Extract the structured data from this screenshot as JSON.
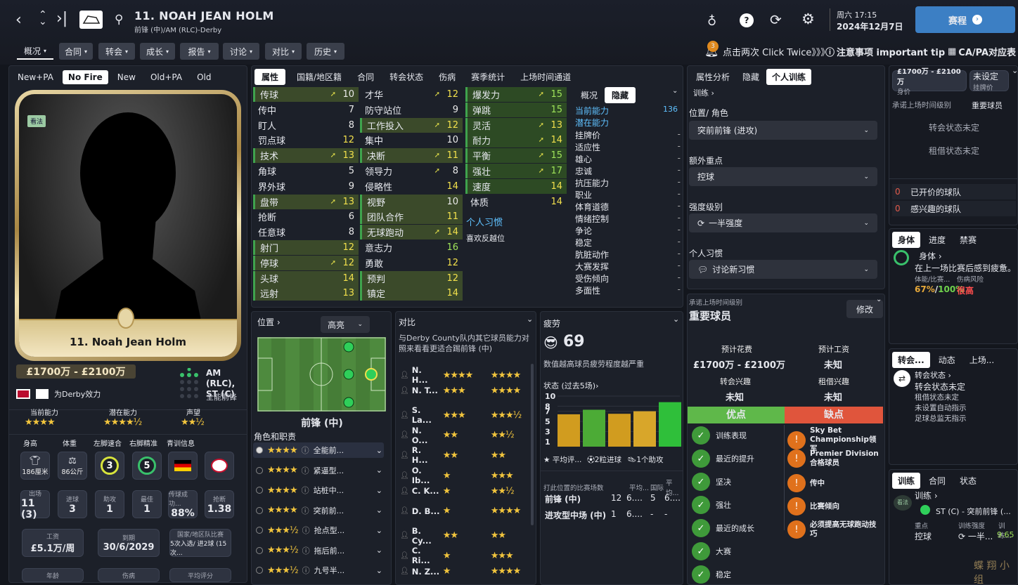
{
  "header": {
    "number_name": "11. NOAH JEAN HOLM",
    "position_club": "前锋 (中)/AM (RLC)-Derby",
    "date_day": "周六 17:15",
    "date": "2024年12月7日",
    "continue_label": "赛程",
    "notif_count": "3"
  },
  "menu_tabs": [
    "概况",
    "合同",
    "转会",
    "成长",
    "报告",
    "讨论",
    "对比",
    "历史"
  ],
  "tips": {
    "click_twice": "点击两次 Click Twice》》》",
    "important": "注意事项 important tip",
    "capa": "CA/PA对应表"
  },
  "face_tabs": [
    "New+PA",
    "No Fire",
    "New",
    "Old+PA",
    "Old"
  ],
  "card": {
    "badge": "看法",
    "name": "11. Noah Jean Holm"
  },
  "value": "£1700万 - £2100万",
  "plays_for": "为Derby效力",
  "pos_short": "AM (RLC),\nST (C)",
  "pos_role": "全能前锋",
  "ratings": {
    "labels": [
      "当前能力",
      "潜在能力",
      "声望"
    ],
    "stars": [
      "★★★★",
      "★★★★½",
      "★★½"
    ]
  },
  "body_stats": {
    "labels": [
      "身高",
      "体重",
      "左脚速合",
      "右脚精准",
      "青训信息"
    ],
    "height": "186厘米",
    "weight": "86公斤",
    "left": "3",
    "right": "5"
  },
  "career": {
    "labels": [
      "出场",
      "进球",
      "助攻",
      "最佳",
      "传球成功...",
      "抢断"
    ],
    "values": [
      "11 (3)",
      "3",
      "1",
      "1",
      "88%",
      "1.38"
    ]
  },
  "contract": {
    "labels": [
      "工资",
      "到期",
      "国家/地区队比赛"
    ],
    "values": [
      "£5.1万/周",
      "30/6/2029",
      "5次入选/ 进2球 (15次..."
    ],
    "bottom": [
      "年龄",
      "伤病",
      "平均评分"
    ]
  },
  "attr_tabs": [
    "属性",
    "国籍/地区籍",
    "合同",
    "转会状态",
    "伤病",
    "赛季统计",
    "上场时间通道"
  ],
  "tech": [
    [
      "传球",
      "10"
    ],
    [
      "传中",
      "7"
    ],
    [
      "盯人",
      "8"
    ],
    [
      "罚点球",
      "12"
    ],
    [
      "技术",
      "13"
    ],
    [
      "角球",
      "5"
    ],
    [
      "界外球",
      "9"
    ],
    [
      "盘带",
      "13"
    ],
    [
      "抢断",
      "6"
    ],
    [
      "任意球",
      "8"
    ],
    [
      "射门",
      "12"
    ],
    [
      "停球",
      "12"
    ],
    [
      "头球",
      "14"
    ],
    [
      "远射",
      "13"
    ]
  ],
  "mental": [
    [
      "才华",
      "12"
    ],
    [
      "防守站位",
      "9"
    ],
    [
      "工作投入",
      "12"
    ],
    [
      "集中",
      "10"
    ],
    [
      "决断",
      "11"
    ],
    [
      "领导力",
      "8"
    ],
    [
      "侵略性",
      "14"
    ],
    [
      "视野",
      "10"
    ],
    [
      "团队合作",
      "11"
    ],
    [
      "无球跑动",
      "14"
    ],
    [
      "意志力",
      "16"
    ],
    [
      "勇敢",
      "12"
    ],
    [
      "预判",
      "12"
    ],
    [
      "镇定",
      "14"
    ]
  ],
  "physical": [
    [
      "爆发力",
      "15"
    ],
    [
      "弹跳",
      "15"
    ],
    [
      "灵活",
      "13"
    ],
    [
      "耐力",
      "14"
    ],
    [
      "平衡",
      "15"
    ],
    [
      "强壮",
      "17"
    ],
    [
      "速度",
      "14"
    ],
    [
      "体质",
      "14"
    ]
  ],
  "habits": {
    "title": "个人习惯",
    "items": [
      "喜欢反越位"
    ]
  },
  "overview": {
    "tabs": [
      "概况",
      "隐藏"
    ],
    "ca": "当前能力",
    "ca_val": "136",
    "pa": "潜在能力",
    "hidden": [
      "挂牌价",
      "适应性",
      "雄心",
      "忠诚",
      "抗压能力",
      "职业",
      "体育道德",
      "情绪控制",
      "争论",
      "稳定",
      "肮脏动作",
      "大赛发挥",
      "受伤倾向",
      "多面性"
    ]
  },
  "training": {
    "tabs": [
      "属性分析",
      "隐藏",
      "个人训练"
    ],
    "link": "训练",
    "role_lbl": "位置/ 角色",
    "role_val": "突前前锋 (进攻)",
    "extra_lbl": "额外重点",
    "extra_val": "控球",
    "intensity_lbl": "强度级别",
    "intensity_val": "一半强度",
    "habit_lbl": "个人习惯",
    "habit_val": "讨论新习惯"
  },
  "side": {
    "asking": "£1700万 - £2100万",
    "asking_lbl": "身价",
    "unset": "未设定",
    "unset_lbl": "挂牌价",
    "promise_lbl": "承诺上场时间级别",
    "promise_val": "重要球员",
    "transfer_status": "转会状态未定",
    "loan_status": "租借状态未定",
    "offers": [
      "已开价的球队",
      "感兴趣的球队"
    ],
    "offer_counts": [
      "0",
      "0"
    ]
  },
  "body_panel": {
    "tabs": [
      "身体",
      "进度",
      "禁赛"
    ],
    "title": "身体",
    "desc": "在上一场比赛后感到疲惫。",
    "sub1": "体能/比赛...",
    "sub2": "伤病风险",
    "val1": "67%",
    "val2": "100%",
    "risk": "很高"
  },
  "trans_panel": {
    "tabs": [
      "转会...",
      "动态",
      "上场..."
    ],
    "title": "转会状态",
    "status": "转会状态未定",
    "items": [
      "租借状态未定",
      "未设置自动指示",
      "足球总监无指示"
    ]
  },
  "train_panel": {
    "tabs": [
      "训练",
      "合同",
      "状态"
    ],
    "link": "训练",
    "badge": "看法",
    "role": "ST (C) - 突前前锋 (...",
    "focus_lbl": "重点",
    "focus": "控球",
    "int_lbl": "训练强度",
    "int": "一半...",
    "rate_lbl": "训练...",
    "rate": "9.65"
  },
  "position": {
    "title": "位置",
    "view": "高亮",
    "label": "前锋 (中)",
    "roles_title": "角色和职责",
    "roles": [
      "全能前...",
      "紧逼型...",
      "站桩中...",
      "突前前...",
      "抢点型...",
      "拖后前...",
      "九号半..."
    ],
    "role_stars": [
      "★★★★",
      "★★★★",
      "★★★★",
      "★★★★",
      "★★★½",
      "★★★½",
      "★★★½"
    ]
  },
  "compare": {
    "title": "对比",
    "desc": "与Derby County队内其它球员能力对照来看看更适合踢前锋 (中)",
    "players": [
      "N. H...",
      "N. T...",
      "S. La...",
      "N. O...",
      "R. H...",
      "O. Ib...",
      "C. K...",
      "D. B...",
      "B. Cy...",
      "C. Ri...",
      "N. Z..."
    ],
    "s1": [
      "★★★★",
      "★★★",
      "★★★",
      "★★",
      "★★",
      "★",
      "★",
      "★",
      "★★",
      "★",
      "★"
    ],
    "s2": [
      "★★★★",
      "★★★★",
      "★★★½",
      "★★½",
      "★★",
      "★★★",
      "★★½",
      "★★★★",
      "★★",
      "★★★",
      "★★★★"
    ]
  },
  "fatigue": {
    "title": "疲劳",
    "value": "69",
    "desc": "数值越高球员疲劳程度越严重",
    "form_title": "状态 (过去5场)",
    "legend": [
      "平均评...",
      "2粒进球",
      "1个助攻"
    ],
    "table_head": [
      "打此位置的比赛场数",
      "平均...",
      "国际",
      "平均..."
    ],
    "rows": [
      [
        "前锋 (中)",
        "12",
        "6....",
        "5",
        "6...."
      ],
      [
        "进攻型中场 (中)",
        "1",
        "6....",
        "-",
        "-"
      ]
    ]
  },
  "chart_data": {
    "type": "bar",
    "categories": [
      "1",
      "2",
      "3",
      "4",
      "5"
    ],
    "values": [
      6.4,
      7.3,
      6.5,
      7.0,
      8.8
    ],
    "ylim": [
      0,
      10
    ],
    "yticks": [
      "10",
      "8",
      "7",
      "5",
      "3",
      "1"
    ]
  },
  "promise": {
    "title": "承诺上场时间级别",
    "value": "重要球员",
    "modify": "修改",
    "fee_lbl": "预计花费",
    "fee": "£1700万 - £2100万",
    "wage_lbl": "预计工资",
    "wage": "未知",
    "tint_lbl": "转会兴趣",
    "tint": "未知",
    "lint_lbl": "租借兴趣",
    "lint": "未知",
    "pros_lbl": "优点",
    "cons_lbl": "缺点",
    "pros": [
      "训练表现",
      "最近的提升",
      "坚决",
      "强壮",
      "最近的成长",
      "大赛",
      "稳定"
    ],
    "cons": [
      "Sky Bet Championship领军",
      "Premier Division合格球员",
      "传中",
      "比赛倾向",
      "必须提高无球跑动技巧"
    ]
  },
  "colors": {
    "accent": "#3f8fd6",
    "pro": "#5fb84a",
    "con": "#e0553c",
    "good": "#2f9e44"
  }
}
